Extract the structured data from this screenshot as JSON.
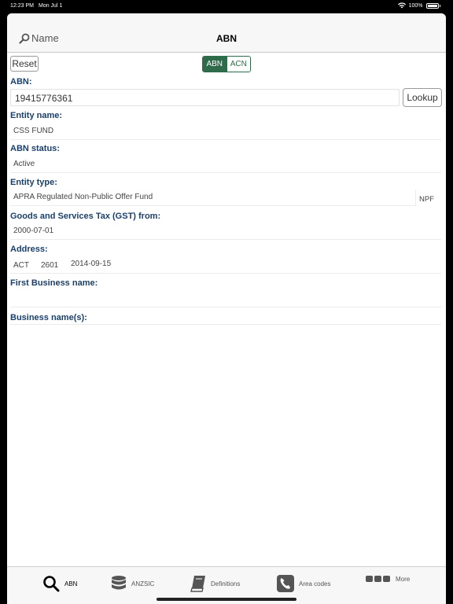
{
  "status_bar": {
    "time": "12:23 PM",
    "date": "Mon Jul 1",
    "battery": "100%"
  },
  "nav": {
    "back_label": "Name",
    "title": "ABN"
  },
  "toolbar": {
    "reset_label": "Reset",
    "segments": [
      "ABN",
      "ACN"
    ],
    "selected_segment": "ABN"
  },
  "form": {
    "abn_label": "ABN:",
    "abn_value": "19415776361",
    "lookup_label": "Lookup",
    "entity_name_label": "Entity name:",
    "entity_name": "CSS FUND",
    "abn_status_label": "ABN status:",
    "abn_status": "Active",
    "entity_type_label": "Entity type:",
    "entity_type": "APRA Regulated Non-Public Offer Fund",
    "entity_type_code": "NPF",
    "gst_label": "Goods and Services Tax (GST) from:",
    "gst_from": "2000-07-01",
    "address_label": "Address:",
    "address_state": "ACT",
    "address_postcode": "2601",
    "address_date": "2014-09-15",
    "first_business_name_label": "First Business name:",
    "business_names_label": "Business name(s):"
  },
  "tabbar": {
    "items": [
      {
        "label": "ABN",
        "icon": "search-icon",
        "active": true
      },
      {
        "label": "ANZSIC",
        "icon": "database-icon",
        "active": false
      },
      {
        "label": "Definitions",
        "icon": "book-icon",
        "active": false
      },
      {
        "label": "Area codes",
        "icon": "phone-icon",
        "active": false
      },
      {
        "label": "More",
        "icon": "more-icon",
        "active": false
      }
    ]
  },
  "colors": {
    "accent": "#2e6b4a",
    "label": "#1b3f6b"
  }
}
